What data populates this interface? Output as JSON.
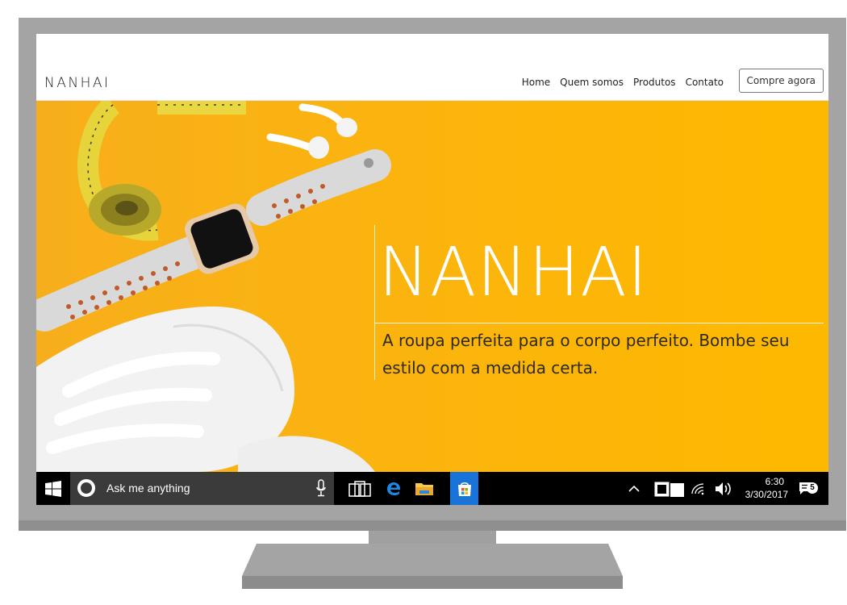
{
  "site": {
    "brand": "NANHAI",
    "nav": [
      "Home",
      "Quem somos",
      "Produtos",
      "Contato"
    ],
    "cta_label": "Compre agora"
  },
  "hero": {
    "title": "NANHAI",
    "tagline": "A roupa perfeita para o corpo perfeito. Bombe seu estilo com a medida certa."
  },
  "taskbar": {
    "search_placeholder": "Ask me anything",
    "time": "6:30",
    "date": "3/30/2017",
    "notification_count": "5",
    "icons": [
      "windows-start-icon",
      "cortana-icon",
      "microphone-icon",
      "task-view-icon",
      "edge-icon",
      "file-explorer-icon",
      "store-icon",
      "chevron-up-icon",
      "tablet-mode-icon",
      "wifi-icon",
      "volume-icon",
      "action-center-icon"
    ],
    "accent": "#1a73d8"
  },
  "colors": {
    "hero_yellow": "#fbb40e",
    "monitor_gray": "#a4a4a4"
  }
}
